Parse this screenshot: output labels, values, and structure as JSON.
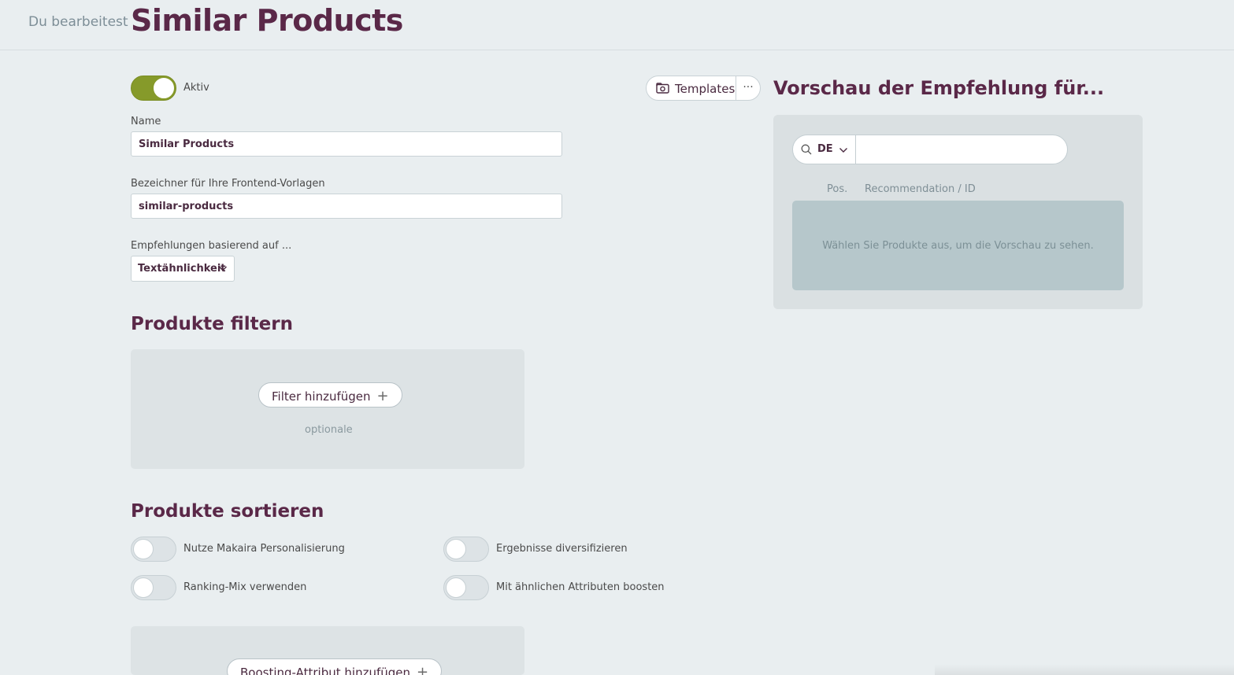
{
  "header": {
    "editing_label": "Du bearbeitest",
    "title": "Similar Products"
  },
  "form": {
    "active_label": "Aktiv",
    "active_on": true,
    "name_label": "Name",
    "name_value": "Similar Products",
    "identifier_label": "Bezeichner für Ihre Frontend-Vorlagen",
    "identifier_value": "similar-products",
    "based_on_label": "Empfehlungen basierend auf ...",
    "based_on_value": "Textähnlichkeit"
  },
  "templates": {
    "label": "Templates",
    "more": "···"
  },
  "filter": {
    "title": "Produkte filtern",
    "add_button": "Filter hinzufügen",
    "hint": "optionale"
  },
  "sort": {
    "title": "Produkte sortieren",
    "toggles": [
      {
        "label": "Nutze Makaira Personalisierung",
        "on": false
      },
      {
        "label": "Ergebnisse diversifizieren",
        "on": false
      },
      {
        "label": "Ranking-Mix verwenden",
        "on": false
      },
      {
        "label": "Mit ähnlichen Attributen boosten",
        "on": false
      }
    ],
    "add_boost_button": "Boosting-Attribut hinzufügen"
  },
  "preview": {
    "title": "Vorschau der Empfehlung für...",
    "language": "DE",
    "search_value": "",
    "col_pos": "Pos.",
    "col_rec": "Recommendation / ID",
    "empty_text": "Wählen Sie Produkte aus, um die Vorschau zu sehen."
  },
  "icons": [
    "search-icon",
    "chevron-down-icon",
    "camera-folder-icon",
    "plus-icon"
  ],
  "colors": {
    "brand": "#5a2848",
    "toggle_active": "#869a2a",
    "background": "#e9eef0"
  }
}
